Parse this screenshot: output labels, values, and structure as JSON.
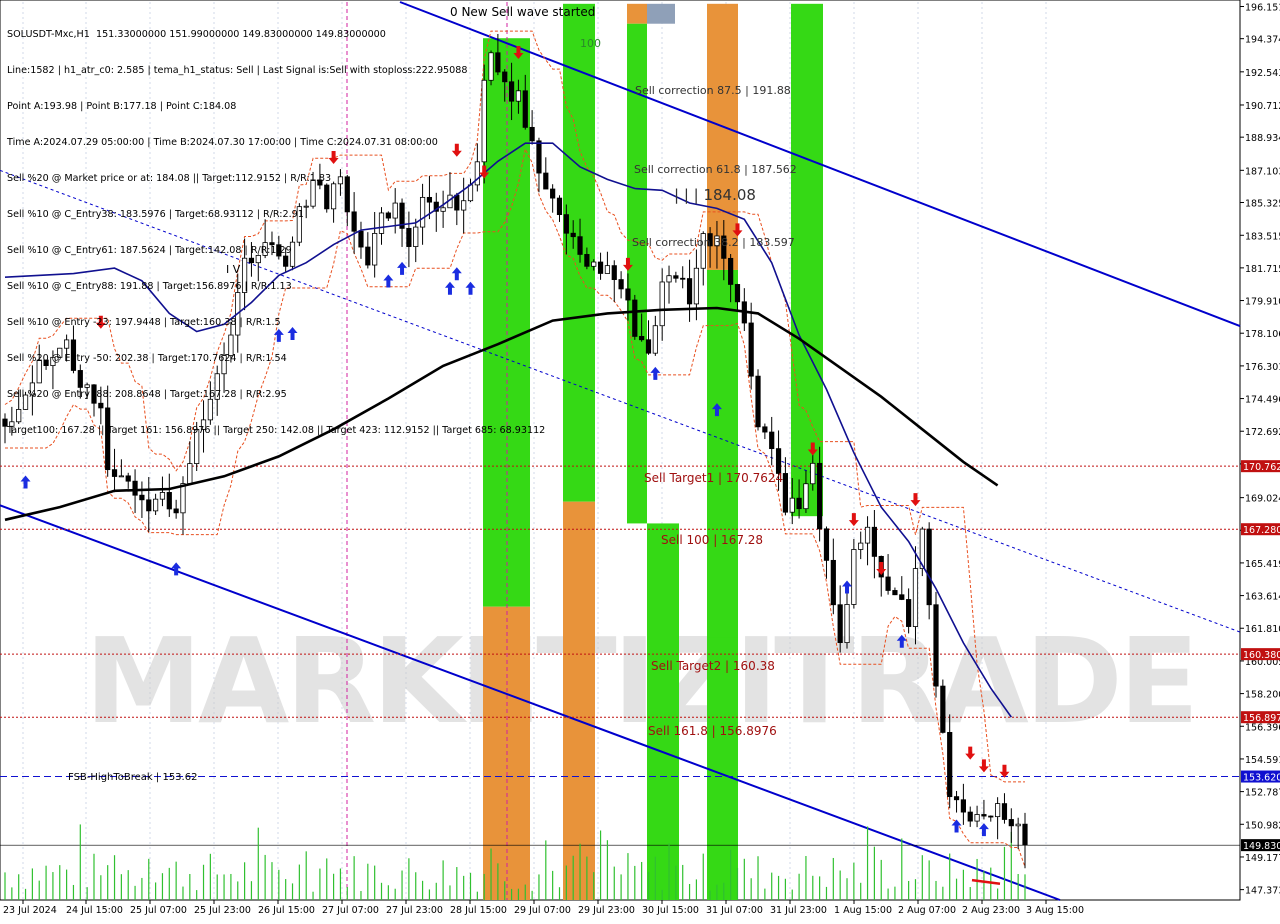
{
  "header": {
    "symbol_line": "SOLUSDT-Mxc,H1  151.33000000 151.99000000 149.83000000 149.83000000",
    "lines": [
      "Line:1582 | h1_atr_c0: 2.585 | tema_h1_status: Sell | Last Signal is:Sell with stoploss:222.95088",
      "Point A:193.98 | Point B:177.18 | Point C:184.08",
      "Time A:2024.07.29 05:00:00 | Time B:2024.07.30 17:00:00 | Time C:2024.07.31 08:00:00",
      "Sell %20 @ Market price or at: 184.08 || Target:112.9152 | R/R:1.83",
      "Sell %10 @ C_Entry38: 183.5976 | Target:68.93112 | R/R:2.91",
      "Sell %10 @ C_Entry61: 187.5624 | Target:142.08 | R/R:1.29",
      "Sell %10 @ C_Entry88: 191.88 | Target:156.8976 | R/R:1.13",
      "Sell %10 @ Entry -23: 197.9448 | Target:160.38 | R/R:1.5",
      "Sell %20 @ Entry -50: 202.38 | Target:170.7624 | R/R:1.54",
      "Sell %20 @ Entry -88: 208.8648 | Target:167.28 | R/R:2.95",
      "Target100: 167.28 || Target 161: 156.8976 || Target 250: 142.08 || Target 423: 112.9152 || Target 685: 68.93112"
    ]
  },
  "annotations": {
    "wave_started": "0 New Sell wave started",
    "label_100": "100",
    "sell_corr_875": "Sell correction 87.5 | 191.88",
    "sell_corr_618": "Sell correction 61.8 | 187.562",
    "point_c": "| | | 184.08",
    "sell_corr_382": "Sell correction 38.2 | 183.597",
    "sell_target1": "Sell Target1 | 170.7624",
    "sell_100": "Sell 100 | 167.28",
    "sell_target2": "Sell Target2 | 160.38",
    "sell_1618": "Sell 161.8 | 156.8976",
    "fsb": "FSB-HighToBreak | 153.62",
    "iv": "I V",
    "watermark": "MARKETIZITRADE"
  },
  "chart_data": {
    "type": "candlestick",
    "symbol": "SOLUSDT-Mxc",
    "timeframe": "H1",
    "ohlc_last": {
      "open": 151.33,
      "high": 151.99,
      "low": 149.83,
      "close": 149.83
    },
    "ylim": [
      146.8,
      196.4
    ],
    "y_ticks": [
      196.151,
      194.374,
      192.543,
      190.712,
      188.934,
      187.103,
      185.325,
      183.515,
      181.715,
      179.91,
      178.106,
      176.301,
      174.496,
      172.692,
      170.887,
      169.024,
      167.222,
      165.419,
      163.614,
      161.81,
      160.005,
      158.2,
      156.396,
      154.591,
      152.787,
      150.982,
      149.177,
      147.373
    ],
    "x_labels": [
      "23 Jul 2024",
      "24 Jul 15:00",
      "25 Jul 07:00",
      "25 Jul 23:00",
      "26 Jul 15:00",
      "27 Jul 07:00",
      "27 Jul 23:00",
      "28 Jul 15:00",
      "29 Jul 07:00",
      "29 Jul 23:00",
      "30 Jul 15:00",
      "31 Jul 07:00",
      "31 Jul 23:00",
      "1 Aug 15:00",
      "2 Aug 07:00",
      "2 Aug 23:00",
      "3 Aug 15:00"
    ],
    "price_levels": [
      {
        "value": 170.762,
        "label": "170.762",
        "color": "#c01010"
      },
      {
        "value": 167.28,
        "label": "167.280",
        "color": "#c01010"
      },
      {
        "value": 160.38,
        "label": "160.380",
        "color": "#c01010"
      },
      {
        "value": 156.897,
        "label": "156.897",
        "color": "#c01010"
      },
      {
        "value": 153.62,
        "label": "153.620",
        "color": "#1010d0"
      },
      {
        "value": 149.83,
        "label": "149.830",
        "color": "#000000"
      }
    ],
    "close_path": [
      [
        0,
        172.5
      ],
      [
        1,
        173.4
      ],
      [
        3,
        175.0
      ],
      [
        5,
        176.8
      ],
      [
        7,
        176.2
      ],
      [
        9,
        177.6
      ],
      [
        10,
        176.0
      ],
      [
        12,
        175.3
      ],
      [
        14,
        174.0
      ],
      [
        15,
        170.8
      ],
      [
        17,
        170.2
      ],
      [
        19,
        169.5
      ],
      [
        21,
        168.1
      ],
      [
        23,
        169.8
      ],
      [
        25,
        168.2
      ],
      [
        27,
        171.5
      ],
      [
        29,
        173.8
      ],
      [
        31,
        176.1
      ],
      [
        33,
        177.8
      ],
      [
        35,
        181.8
      ],
      [
        37,
        183.0
      ],
      [
        39,
        182.4
      ],
      [
        41,
        181.5
      ],
      [
        43,
        184.6
      ],
      [
        45,
        186.8
      ],
      [
        47,
        185.5
      ],
      [
        49,
        186.9
      ],
      [
        51,
        183.2
      ],
      [
        53,
        182.3
      ],
      [
        55,
        184.5
      ],
      [
        57,
        185.6
      ],
      [
        59,
        183.1
      ],
      [
        61,
        185.9
      ],
      [
        63,
        184.8
      ],
      [
        65,
        185.2
      ],
      [
        67,
        185.6
      ],
      [
        69,
        188.0
      ],
      [
        70,
        192.5
      ],
      [
        71,
        193.8
      ],
      [
        72,
        193.0
      ],
      [
        74,
        191.4
      ],
      [
        75,
        191.6
      ],
      [
        76,
        189.7
      ],
      [
        78,
        187.0
      ],
      [
        80,
        185.1
      ],
      [
        82,
        183.8
      ],
      [
        84,
        182.5
      ],
      [
        86,
        181.7
      ],
      [
        88,
        181.7
      ],
      [
        90,
        180.6
      ],
      [
        92,
        178.4
      ],
      [
        94,
        177.1
      ],
      [
        96,
        180.6
      ],
      [
        98,
        181.5
      ],
      [
        100,
        180.2
      ],
      [
        102,
        183.3
      ],
      [
        104,
        183.6
      ],
      [
        106,
        181.4
      ],
      [
        108,
        178.4
      ],
      [
        110,
        173.5
      ],
      [
        112,
        171.8
      ],
      [
        114,
        168.8
      ],
      [
        116,
        168.5
      ],
      [
        118,
        170.6
      ],
      [
        120,
        165.0
      ],
      [
        122,
        160.5
      ],
      [
        124,
        166.4
      ],
      [
        126,
        166.9
      ],
      [
        128,
        164.2
      ],
      [
        130,
        163.8
      ],
      [
        132,
        162.3
      ],
      [
        134,
        167.2
      ],
      [
        136,
        158.8
      ],
      [
        138,
        153.0
      ],
      [
        140,
        151.8
      ],
      [
        142,
        151.5
      ],
      [
        144,
        152.0
      ],
      [
        146,
        151.1
      ],
      [
        148,
        151.3
      ],
      [
        149,
        149.83
      ]
    ],
    "ema_blue": [
      [
        0,
        181.2
      ],
      [
        10,
        181.4
      ],
      [
        16,
        181.7
      ],
      [
        20,
        181.0
      ],
      [
        24,
        179.2
      ],
      [
        28,
        178.2
      ],
      [
        32,
        178.6
      ],
      [
        36,
        179.8
      ],
      [
        40,
        181.3
      ],
      [
        44,
        182.0
      ],
      [
        48,
        183.0
      ],
      [
        52,
        183.8
      ],
      [
        56,
        184.0
      ],
      [
        60,
        184.2
      ],
      [
        64,
        185.2
      ],
      [
        68,
        186.3
      ],
      [
        72,
        187.6
      ],
      [
        76,
        188.6
      ],
      [
        80,
        188.6
      ],
      [
        84,
        187.3
      ],
      [
        88,
        186.6
      ],
      [
        92,
        186.1
      ],
      [
        96,
        186.0
      ],
      [
        100,
        185.3
      ],
      [
        104,
        185.0
      ],
      [
        108,
        184.4
      ],
      [
        112,
        182.0
      ],
      [
        116,
        178.0
      ],
      [
        120,
        175.0
      ],
      [
        124,
        171.5
      ],
      [
        128,
        168.5
      ],
      [
        132,
        166.6
      ],
      [
        136,
        164.0
      ],
      [
        140,
        161.0
      ],
      [
        144,
        158.5
      ],
      [
        147,
        156.9
      ]
    ],
    "ma_black": [
      [
        0,
        167.8
      ],
      [
        8,
        168.5
      ],
      [
        16,
        169.4
      ],
      [
        24,
        169.5
      ],
      [
        32,
        170.2
      ],
      [
        40,
        171.3
      ],
      [
        48,
        172.8
      ],
      [
        56,
        174.5
      ],
      [
        64,
        176.3
      ],
      [
        72,
        177.5
      ],
      [
        80,
        178.8
      ],
      [
        88,
        179.2
      ],
      [
        96,
        179.4
      ],
      [
        104,
        179.5
      ],
      [
        110,
        179.2
      ],
      [
        116,
        177.8
      ],
      [
        122,
        176.2
      ],
      [
        128,
        174.6
      ],
      [
        134,
        172.8
      ],
      [
        140,
        171.0
      ],
      [
        145,
        169.7
      ]
    ],
    "colors": {
      "green": "#35d915",
      "orange": "#e8933a",
      "blue": "#0000cc",
      "red": "#e01010",
      "grid": "#d0d8e8",
      "watermark": "#cccccc"
    }
  }
}
